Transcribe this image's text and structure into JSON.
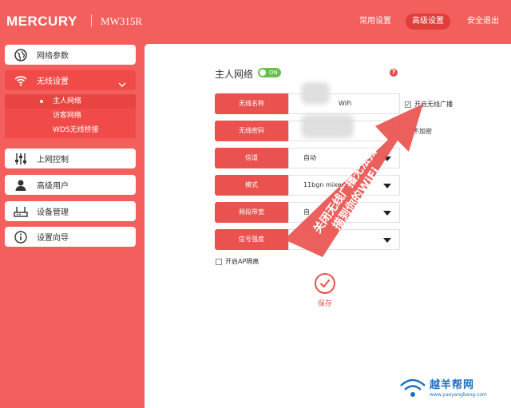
{
  "header": {
    "brand": "MERCURY",
    "model": "MW315R",
    "nav": [
      {
        "label": "常用设置",
        "active": false
      },
      {
        "label": "高级设置",
        "active": true
      },
      {
        "label": "安全退出",
        "active": false
      }
    ]
  },
  "sidebar": {
    "items": [
      {
        "label": "网络参数",
        "icon": "globe-icon"
      },
      {
        "label": "无线设置",
        "icon": "wifi-icon"
      },
      {
        "label": "上网控制",
        "icon": "sliders-icon"
      },
      {
        "label": "高级用户",
        "icon": "user-icon"
      },
      {
        "label": "设备管理",
        "icon": "router-icon"
      },
      {
        "label": "设置向导",
        "icon": "info-icon"
      }
    ],
    "submenu": [
      {
        "label": "主人网络",
        "active": true
      },
      {
        "label": "访客网络",
        "active": false
      },
      {
        "label": "WDS无线桥接",
        "active": false
      }
    ]
  },
  "main": {
    "section_title": "主人网络",
    "toggle_label": "ON",
    "help": "?",
    "fields": [
      {
        "label": "无线名称",
        "value": "WiFi"
      },
      {
        "label": "无线密码",
        "value": ""
      },
      {
        "label": "信道",
        "value": "自动"
      },
      {
        "label": "模式",
        "value": "11bgn mixed"
      },
      {
        "label": "频段带宽",
        "value": "自"
      },
      {
        "label": "信号强度",
        "value": ""
      }
    ],
    "broadcast_label": "开启无线广播",
    "no_encrypt_label": "不加密",
    "ap_isolation_label": "开启AP隔离",
    "save_label": "保存"
  },
  "annotation": {
    "line1": "关闭无线广播无法扫",
    "line2": "描到你的WiFi"
  },
  "watermark": {
    "name": "越羊帮网",
    "url": "www.yueyangbang.com"
  },
  "colors": {
    "brand_red": "#f25f5c",
    "label_red": "#e9524f",
    "toggle_green": "#66c14a",
    "watermark_blue": "#1c6fbf"
  }
}
